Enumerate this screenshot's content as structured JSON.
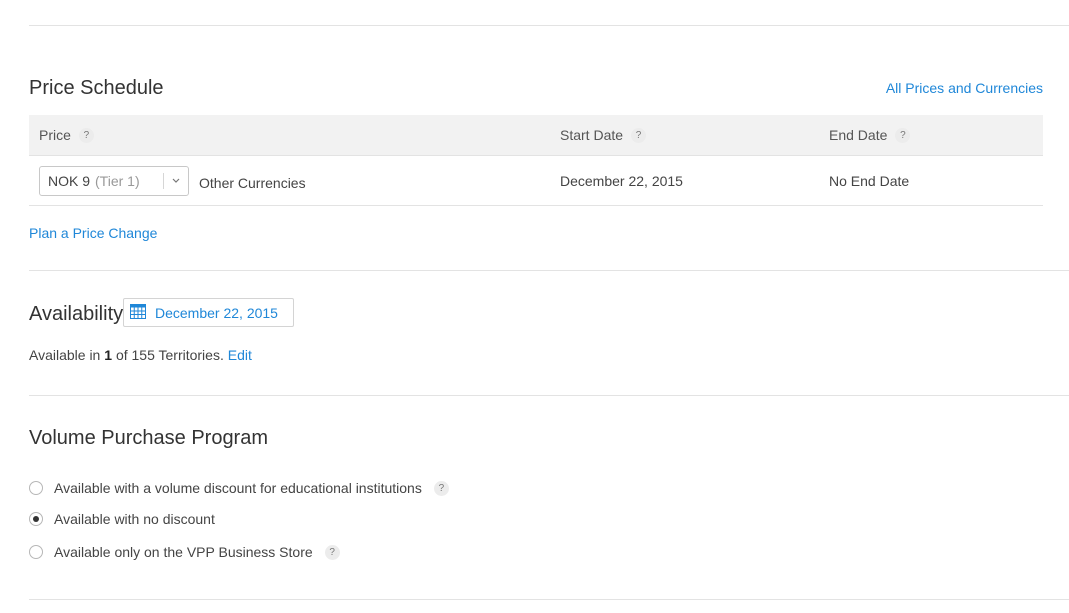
{
  "price_schedule": {
    "title": "Price Schedule",
    "all_prices_link": "All Prices and Currencies",
    "columns": {
      "price": "Price",
      "start_date": "Start Date",
      "end_date": "End Date"
    },
    "help_glyph": "?",
    "row": {
      "price_value": "NOK 9",
      "price_tier": "(Tier 1)",
      "other_currencies": "Other Currencies",
      "start_date": "December 22, 2015",
      "end_date": "No End Date"
    },
    "plan_change_link": "Plan a Price Change"
  },
  "availability": {
    "title": "Availability",
    "date": "December 22, 2015",
    "text_prefix": "Available in",
    "count": "1",
    "text_suffix": "of 155 Territories.",
    "edit_link": "Edit"
  },
  "vpp": {
    "title": "Volume Purchase Program",
    "options": [
      {
        "label": "Available with a volume discount for educational institutions",
        "selected": false,
        "help": true
      },
      {
        "label": "Available with no discount",
        "selected": true,
        "help": false
      },
      {
        "label": "Available only on the VPP Business Store",
        "selected": false,
        "help": true
      }
    ]
  },
  "colors": {
    "link": "#1f87d8",
    "header_bg": "#f2f2f2",
    "divider": "#e3e3e3"
  }
}
